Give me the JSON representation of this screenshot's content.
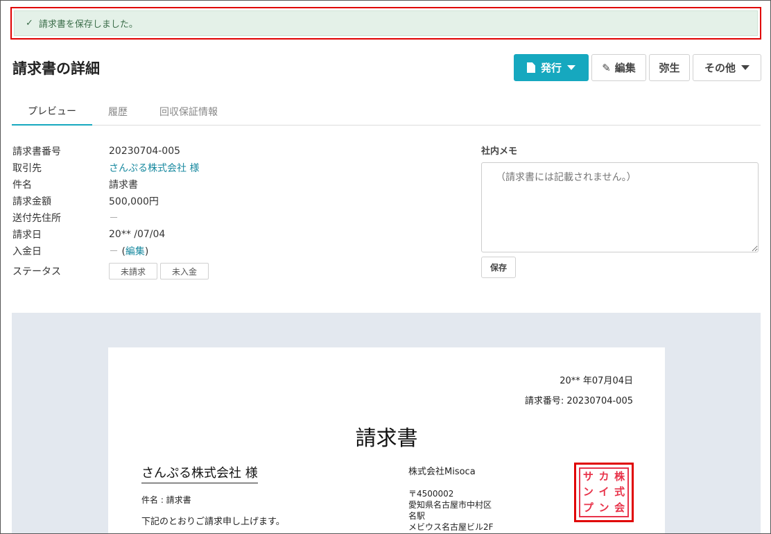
{
  "flash": {
    "icon": "check-icon",
    "check_glyph": "✓",
    "message": "請求書を保存しました。"
  },
  "page": {
    "title": "請求書の詳細"
  },
  "actions": {
    "issue": "発行",
    "edit": "編集",
    "yayoi": "弥生",
    "other": "その他"
  },
  "tabs": [
    "プレビュー",
    "履歴",
    "回収保証情報"
  ],
  "details": {
    "invoice_no_label": "請求書番号",
    "invoice_no": "20230704-005",
    "client_label": "取引先",
    "client": "さんぷる株式会社 様",
    "subject_label": "件名",
    "subject": "請求書",
    "amount_label": "請求金額",
    "amount": "500,000円",
    "address_label": "送付先住所",
    "address": "－",
    "bill_date_label": "請求日",
    "bill_date": "20** /07/04",
    "paid_date_label": "入金日",
    "paid_date_dash": "－",
    "paid_date_open": " (",
    "paid_date_edit": "編集",
    "paid_date_close": ")",
    "status_label": "ステータス",
    "status1": "未請求",
    "status2": "未入金"
  },
  "memo": {
    "label": "社内メモ",
    "placeholder": "（請求書には記載されません。）",
    "save": "保存"
  },
  "preview": {
    "date": "20** 年07月04日",
    "number": "請求番号: 20230704-005",
    "title": "請求書",
    "client": "さんぷる株式会社 様",
    "subject": "件名 : 請求書",
    "lead": "下記のとおりご請求申し上げます。",
    "company": "株式会社Misoca",
    "postal": "〒4500002",
    "addr1": "愛知県名古屋市中村区",
    "addr2": "名駅",
    "addr3": "メビウス名古屋ビル2F",
    "seal_chars": [
      "サ",
      "カ",
      "株",
      "ン",
      "イ",
      "式",
      "プ",
      "ン",
      "会"
    ]
  },
  "colors": {
    "accent": "#16a8bf",
    "success_bg": "#e4f1e8",
    "highlight": "#e00000",
    "seal": "#e8334a"
  }
}
